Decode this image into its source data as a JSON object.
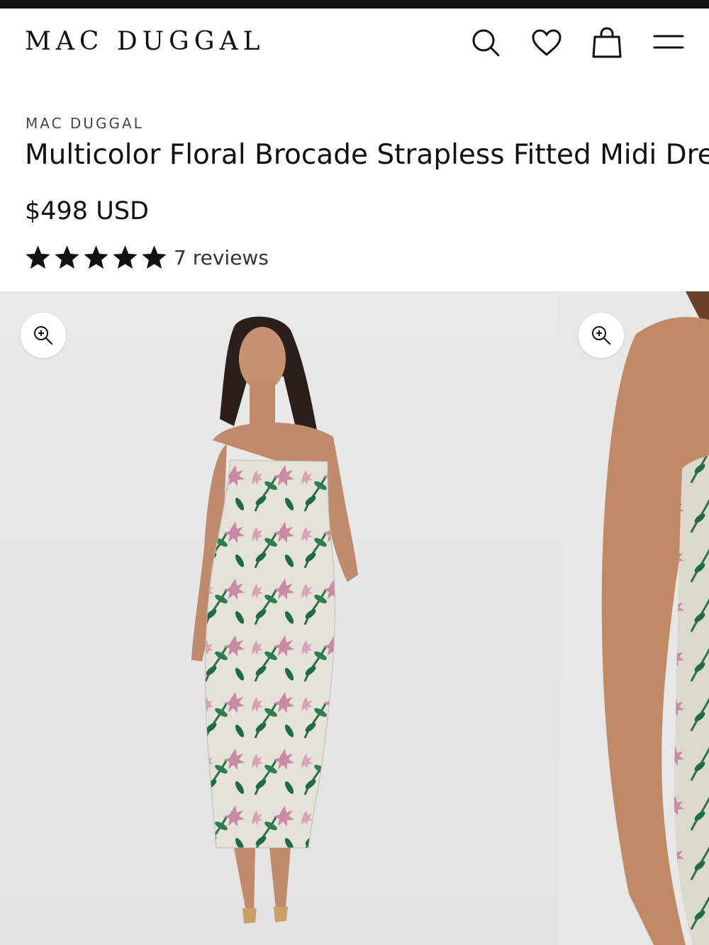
{
  "header": {
    "logo": "MAC DUGGAL",
    "icons": [
      "search-icon",
      "heart-icon",
      "shopping-bag-icon",
      "menu-icon"
    ]
  },
  "product": {
    "brand": "MAC DUGGAL",
    "title": "Multicolor Floral Brocade Strapless Fitted Midi Dress",
    "price": "$498 USD",
    "rating": 5,
    "rating_max": 5,
    "reviews_label": "7 reviews"
  },
  "gallery": {
    "zoom_icon": "zoom-in-icon",
    "slides": [
      {
        "description_icon": "product-image"
      },
      {
        "description_icon": "product-image"
      }
    ]
  },
  "colors": {
    "text": "#111111",
    "background": "#ffffff",
    "image_bg": "#e6e6e6",
    "print_green": "#1f6b43",
    "print_pink": "#c98aa3"
  }
}
